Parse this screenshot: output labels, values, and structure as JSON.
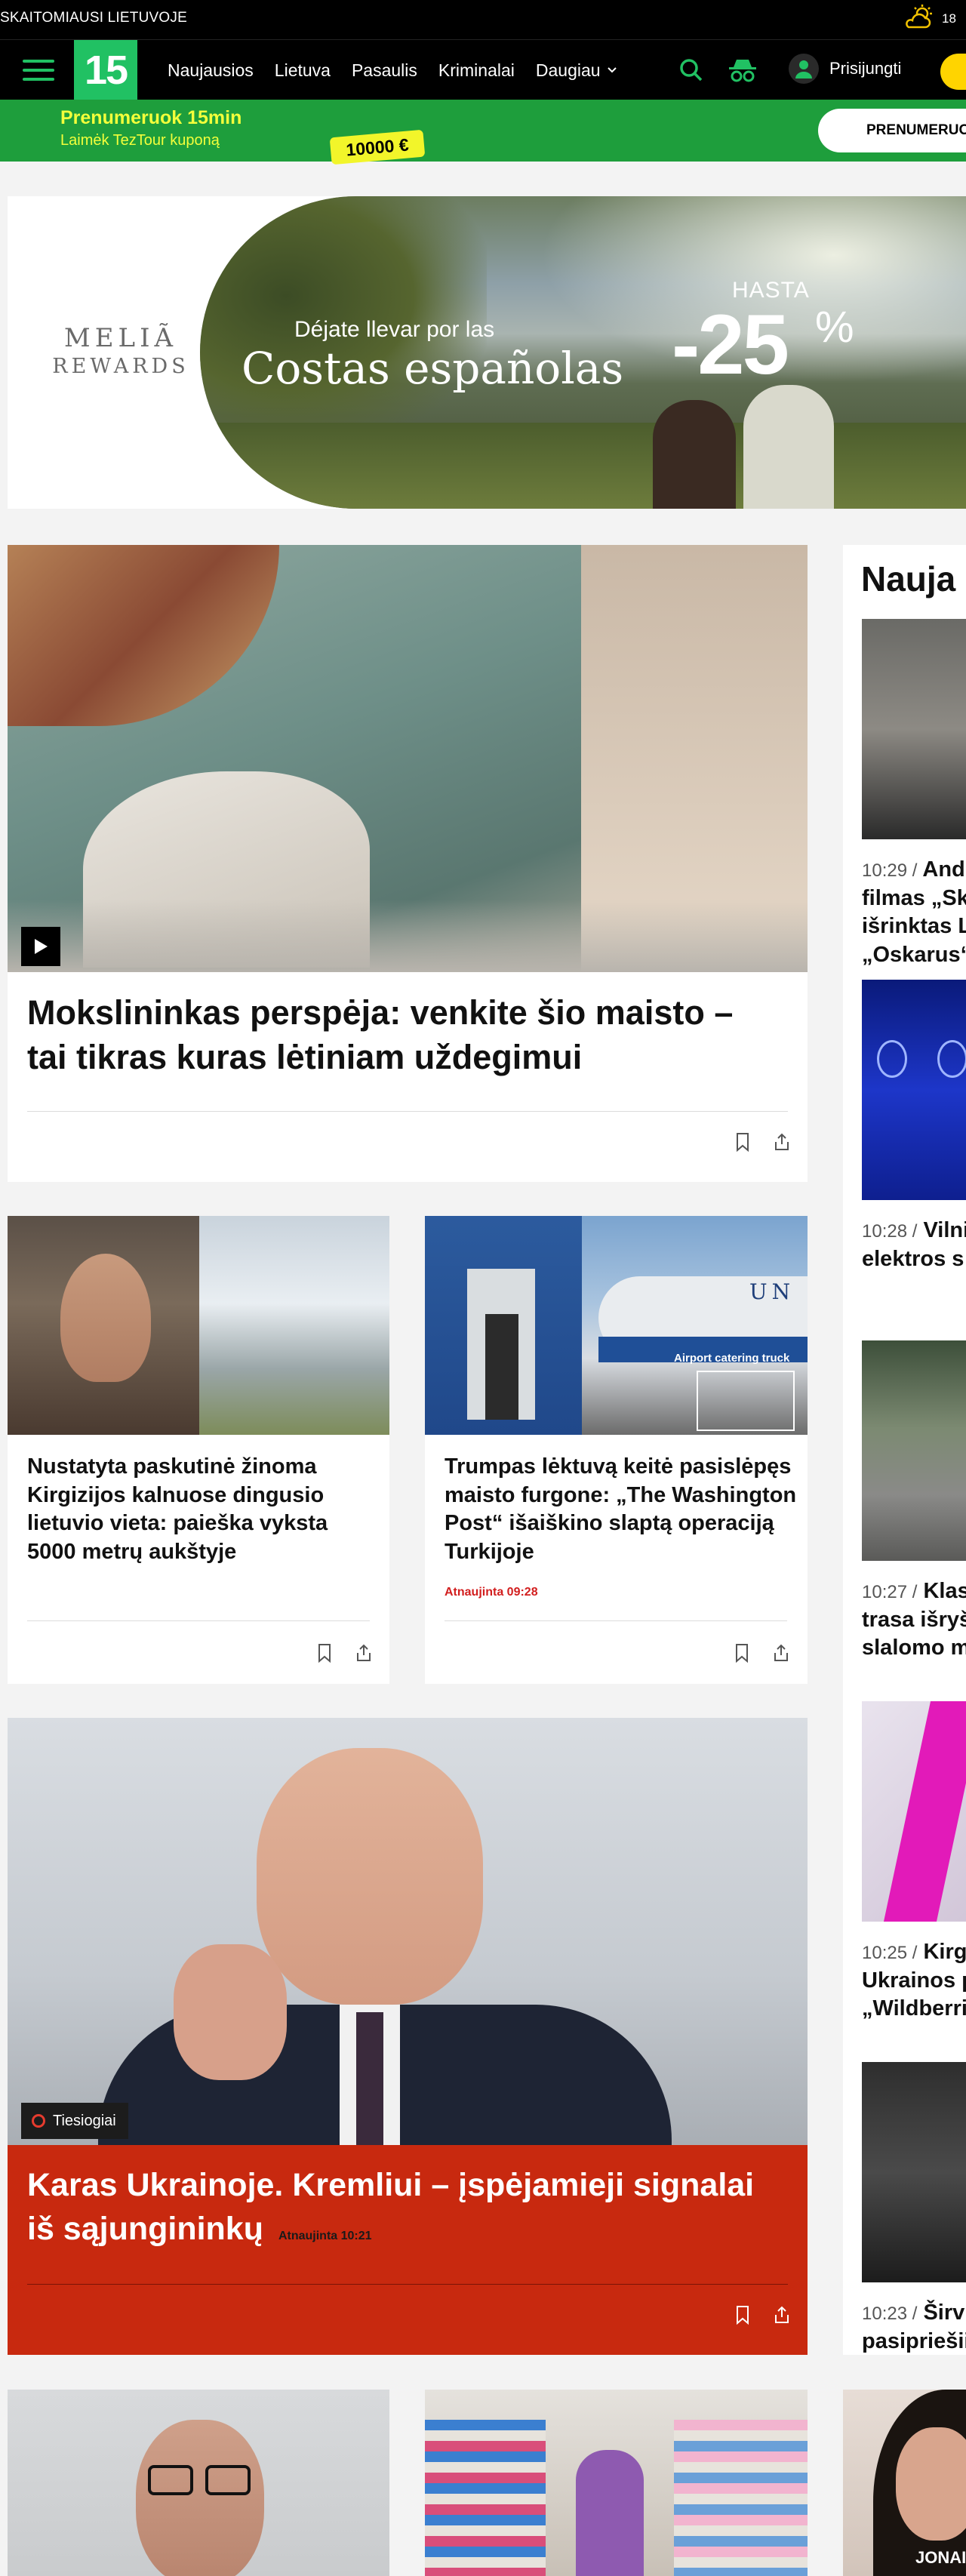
{
  "top_bar": {
    "slogan": "SKAITOMIAUSI LIETUVOJE",
    "temperature": "18"
  },
  "nav": {
    "logo": "15",
    "links": [
      "Naujausios",
      "Lietuva",
      "Pasaulis",
      "Kriminalai"
    ],
    "more_label": "Daugiau",
    "login_label": "Prisijungti",
    "accent_color": "#21c163"
  },
  "promo": {
    "title": "Prenumeruok 15min",
    "subtitle": "Laimėk TezTour kuponą",
    "coupon": "10000 €",
    "button": "Prenumeruo"
  },
  "ad": {
    "brand_line1": "MELIÃ",
    "brand_line2": "REWARDS",
    "slogan_line1": "Déjate llevar por las",
    "slogan_line2": "Costas españolas",
    "hasta": "HASTA",
    "discount": "-25",
    "percent": "%"
  },
  "main_story": {
    "headline": "Mokslininkas perspėja: venkite šio maisto – tai tikras kuras lėtiniam uždegimui"
  },
  "story_2": {
    "headline": "Nustatyta paskutinė žinoma Kirgizijos kalnuose dingusio lietuvio vieta: paieška vyksta 5000 metrų aukštyje"
  },
  "story_3": {
    "headline": "Trumpas lėktuvą keitė pasislėpęs maisto furgone: „The Washington Post“ išaiškino slaptą operaciją Turkijoje",
    "updated": "Atnaujinta 09:28",
    "image_caption": "Airport catering truck",
    "plane_text": "UN"
  },
  "live_story": {
    "badge": "Tiesiogiai",
    "headline": "Karas Ukrainoje. Kremliui – įspėjamieji signalai iš sąjungininkų",
    "updated": "Atnaujinta 10:21",
    "bg_color": "#c8290f"
  },
  "sidebar": {
    "title": "Nauja",
    "items": [
      {
        "time": "10:29 /",
        "lines": [
          "Andr",
          "filmas „Sk",
          "išrinktas L",
          "„Oskarus“"
        ]
      },
      {
        "time": "10:28 /",
        "lines": [
          "Vilni",
          "elektros s"
        ]
      },
      {
        "time": "10:27 /",
        "lines": [
          "Klas",
          "trasa išryš",
          "slalomo m"
        ]
      },
      {
        "time": "10:25 /",
        "lines": [
          "Kirg",
          "Ukrainos p",
          "„Wildberri"
        ]
      },
      {
        "time": "10:23 /",
        "lines": [
          "Širvi",
          "pasipriešii"
        ]
      }
    ]
  },
  "bottom_row": {
    "card3_caption": "JONAI"
  }
}
